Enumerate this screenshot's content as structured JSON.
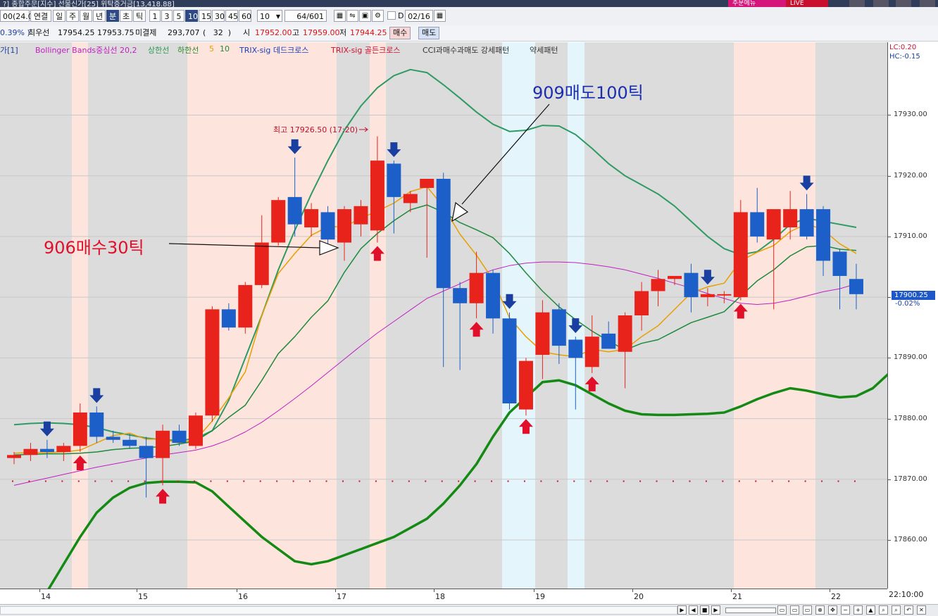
{
  "titlebar": {
    "text": "?] 종합주문[지수] 선물신가[25] 위탁증거금[13,418.88]",
    "btn_a": "주문메뉴",
    "btn_b": "LIVE"
  },
  "toolbar": {
    "code": "00(24.0",
    "link_label": "연결",
    "periods": [
      "일",
      "주",
      "월",
      "년",
      "분",
      "초",
      "틱"
    ],
    "active_period": "분",
    "intervals": [
      "1",
      "3",
      "5",
      "10",
      "15",
      "30",
      "45",
      "60"
    ],
    "active_interval": "10",
    "interval_value": "10",
    "count": "64",
    "count_total": "/601",
    "d_label": "D",
    "date": "02/16"
  },
  "quote": {
    "pct": "0.39%",
    "best_ask_label": "최우선",
    "best_ask": "17954.25",
    "best_bid": "17953.75",
    "unsettled_label": "미결제",
    "unsettled": "293,707",
    "unsettled_chg": "32",
    "open_label": "시",
    "open": "17952.00",
    "high_label": "고",
    "high": "17959.00",
    "low_label": "저",
    "low": "17944.25",
    "buy_label": "매수",
    "sell_label": "매도"
  },
  "legend": {
    "price": "가[1]",
    "bb": "Bollinger Bands중심선 20,2",
    "upper": "상한선",
    "lower": "하한선",
    "ma5": "5",
    "ma10": "10",
    "trix_dead": "TRIX-sig 데드크로스",
    "trix_golden": "TRIX-sig 골든크로스",
    "cci": "CCI과매수과매도 강세패턴",
    "weak": "약세패턴"
  },
  "annotations": {
    "buy_note": "906매수30틱",
    "sell_note": "909매도100틱",
    "high_marker": "최고 17926.50 (17:20)"
  },
  "axis_right": {
    "lc": "LC:0.20",
    "hc": "HC:-0.15",
    "ticks": [
      "17930.00",
      "17920.00",
      "17910.00",
      "17900.00",
      "17890.00",
      "17880.00",
      "17870.00",
      "17860.00"
    ],
    "last_price": "17900.25",
    "last_pct": "-0.02%",
    "time": "22:10:00"
  },
  "chart_data": {
    "type": "candlestick",
    "x_labels": [
      "14",
      "15",
      "16",
      "17",
      "18",
      "19",
      "20",
      "21",
      "22"
    ],
    "ylim": [
      17852,
      17942
    ],
    "candles": [
      {
        "o": 17873.5,
        "h": 17874.5,
        "l": 17872.5,
        "c": 17874.0
      },
      {
        "o": 17874.0,
        "h": 17876.0,
        "l": 17873.0,
        "c": 17875.0
      },
      {
        "o": 17875.0,
        "h": 17876.5,
        "l": 17873.5,
        "c": 17874.5
      },
      {
        "o": 17874.5,
        "h": 17876.0,
        "l": 17873.0,
        "c": 17875.5
      },
      {
        "o": 17875.5,
        "h": 17882.5,
        "l": 17874.5,
        "c": 17881.0
      },
      {
        "o": 17881.0,
        "h": 17882.0,
        "l": 17876.0,
        "c": 17877.0
      },
      {
        "o": 17877.0,
        "h": 17878.0,
        "l": 17876.0,
        "c": 17876.5
      },
      {
        "o": 17876.5,
        "h": 17877.5,
        "l": 17875.0,
        "c": 17875.5
      },
      {
        "o": 17875.5,
        "h": 17877.0,
        "l": 17867.0,
        "c": 17873.5
      },
      {
        "o": 17873.5,
        "h": 17879.0,
        "l": 17869.0,
        "c": 17878.0
      },
      {
        "o": 17878.0,
        "h": 17879.0,
        "l": 17875.5,
        "c": 17876.0
      },
      {
        "o": 17875.5,
        "h": 17881.0,
        "l": 17875.0,
        "c": 17880.5
      },
      {
        "o": 17880.5,
        "h": 17898.5,
        "l": 17879.5,
        "c": 17898.0
      },
      {
        "o": 17898.0,
        "h": 17899.0,
        "l": 17894.5,
        "c": 17895.0
      },
      {
        "o": 17895.0,
        "h": 17902.5,
        "l": 17894.0,
        "c": 17902.0
      },
      {
        "o": 17902.0,
        "h": 17913.5,
        "l": 17901.5,
        "c": 17909.0
      },
      {
        "o": 17909.0,
        "h": 17916.5,
        "l": 17908.5,
        "c": 17916.0
      },
      {
        "o": 17916.5,
        "h": 17923.0,
        "l": 17910.0,
        "c": 17912.0
      },
      {
        "o": 17911.5,
        "h": 17915.5,
        "l": 17910.0,
        "c": 17914.5
      },
      {
        "o": 17914.0,
        "h": 17915.0,
        "l": 17907.5,
        "c": 17909.5
      },
      {
        "o": 17909.0,
        "h": 17915.0,
        "l": 17906.0,
        "c": 17914.5
      },
      {
        "o": 17912.0,
        "h": 17916.0,
        "l": 17910.0,
        "c": 17915.0
      },
      {
        "o": 17911.0,
        "h": 17926.5,
        "l": 17909.0,
        "c": 17922.5
      },
      {
        "o": 17922.0,
        "h": 17922.5,
        "l": 17910.5,
        "c": 17916.5
      },
      {
        "o": 17915.5,
        "h": 17917.5,
        "l": 17914.0,
        "c": 17917.0
      },
      {
        "o": 17918.0,
        "h": 17919.0,
        "l": 17906.5,
        "c": 17919.5
      },
      {
        "o": 17919.5,
        "h": 17920.5,
        "l": 17888.5,
        "c": 17901.5
      },
      {
        "o": 17901.5,
        "h": 17902.5,
        "l": 17888.0,
        "c": 17899.0
      },
      {
        "o": 17899.0,
        "h": 17907.5,
        "l": 17896.5,
        "c": 17904.0
      },
      {
        "o": 17904.0,
        "h": 17904.5,
        "l": 17894.0,
        "c": 17896.5
      },
      {
        "o": 17896.5,
        "h": 17897.5,
        "l": 17881.5,
        "c": 17882.5
      },
      {
        "o": 17881.5,
        "h": 17890.0,
        "l": 17880.5,
        "c": 17889.5
      },
      {
        "o": 17890.5,
        "h": 17899.5,
        "l": 17886.5,
        "c": 17897.5
      },
      {
        "o": 17898.0,
        "h": 17899.0,
        "l": 17889.0,
        "c": 17892.0
      },
      {
        "o": 17893.0,
        "h": 17893.5,
        "l": 17881.5,
        "c": 17890.0
      },
      {
        "o": 17888.5,
        "h": 17897.0,
        "l": 17887.5,
        "c": 17893.5
      },
      {
        "o": 17894.0,
        "h": 17896.0,
        "l": 17891.5,
        "c": 17891.5
      },
      {
        "o": 17891.0,
        "h": 17897.5,
        "l": 17885.0,
        "c": 17897.0
      },
      {
        "o": 17897.0,
        "h": 17902.5,
        "l": 17894.5,
        "c": 17901.0
      },
      {
        "o": 17901.0,
        "h": 17904.5,
        "l": 17898.5,
        "c": 17903.0
      },
      {
        "o": 17903.0,
        "h": 17903.5,
        "l": 17902.0,
        "c": 17903.5
      },
      {
        "o": 17904.0,
        "h": 17905.5,
        "l": 17897.5,
        "c": 17900.0
      },
      {
        "o": 17900.0,
        "h": 17901.5,
        "l": 17898.5,
        "c": 17900.5
      },
      {
        "o": 17900.5,
        "h": 17901.0,
        "l": 17899.0,
        "c": 17900.5
      },
      {
        "o": 17900.0,
        "h": 17916.0,
        "l": 17899.5,
        "c": 17914.0
      },
      {
        "o": 17914.0,
        "h": 17918.0,
        "l": 17909.0,
        "c": 17910.0
      },
      {
        "o": 17909.5,
        "h": 17914.5,
        "l": 17898.0,
        "c": 17914.5
      },
      {
        "o": 17911.5,
        "h": 17917.5,
        "l": 17909.5,
        "c": 17914.5
      },
      {
        "o": 17914.5,
        "h": 17917.0,
        "l": 17909.5,
        "c": 17910.0
      },
      {
        "o": 17914.5,
        "h": 17915.0,
        "l": 17903.5,
        "c": 17906.0
      },
      {
        "o": 17907.5,
        "h": 17908.0,
        "l": 17898.0,
        "c": 17903.5
      },
      {
        "o": 17903.0,
        "h": 17905.5,
        "l": 17898.0,
        "c": 17900.5
      }
    ],
    "ma5": [
      17874.3,
      17874.4,
      17874.4,
      17874.5,
      17874.8,
      17876.0,
      17877.2,
      17877.6,
      17876.6,
      17876.6,
      17876.0,
      17876.5,
      17879.6,
      17883.4,
      17887.7,
      17897.0,
      17903.9,
      17907.2,
      17910.2,
      17911.6,
      17911.6,
      17913.0,
      17914.2,
      17915.5,
      17917.4,
      17918.2,
      17914.9,
      17910.4,
      17906.9,
      17902.9,
      17896.6,
      17893.5,
      17891.0,
      17890.5,
      17890.2,
      17891.4,
      17891.0,
      17891.4,
      17893.5,
      17895.3,
      17898.0,
      17900.7,
      17901.7,
      17902.3,
      17906.0,
      17907.4,
      17908.5,
      17910.8,
      17912.1,
      17911.1,
      17908.8,
      17907.2
    ],
    "ma10": [
      17874.0,
      17874.1,
      17874.2,
      17874.2,
      17874.3,
      17874.5,
      17874.9,
      17875.1,
      17875.2,
      17875.4,
      17875.8,
      17876.3,
      17878.0,
      17880.2,
      17882.2,
      17886.3,
      17890.7,
      17893.5,
      17896.7,
      17899.4,
      17904.1,
      17908.0,
      17910.5,
      17912.6,
      17914.4,
      17915.2,
      17914.0,
      17912.3,
      17911.1,
      17909.8,
      17907.2,
      17904.0,
      17901.0,
      17898.4,
      17896.3,
      17894.4,
      17892.8,
      17891.3,
      17892.4,
      17893.0,
      17894.4,
      17895.8,
      17896.7,
      17897.6,
      17900.2,
      17902.7,
      17904.5,
      17906.8,
      17908.3,
      17908.5,
      17907.9,
      17907.7
    ],
    "bb_mid": [
      17869.0,
      17869.6,
      17870.2,
      17870.8,
      17871.4,
      17872.0,
      17872.5,
      17873.0,
      17873.5,
      17874.0,
      17874.4,
      17874.8,
      17875.5,
      17876.5,
      17877.8,
      17879.4,
      17881.3,
      17883.3,
      17885.4,
      17887.6,
      17889.8,
      17892.0,
      17894.1,
      17896.0,
      17897.9,
      17899.8,
      17901.0,
      17902.2,
      17903.5,
      17904.5,
      17905.2,
      17905.6,
      17905.8,
      17905.8,
      17905.7,
      17905.4,
      17905.0,
      17904.5,
      17903.8,
      17903.1,
      17902.3,
      17901.5,
      17900.6,
      17899.8,
      17899.0,
      17898.8,
      17899.0,
      17899.5,
      17900.2,
      17900.9,
      17901.4,
      17902.2
    ],
    "bb_upper": [
      17879.0,
      17879.2,
      17879.3,
      17879.2,
      17879.0,
      17878.5,
      17877.8,
      17877.3,
      17876.8,
      17876.5,
      17876.4,
      17876.7,
      17878.0,
      17883.0,
      17890.0,
      17897.0,
      17904.5,
      17911.0,
      17917.0,
      17922.5,
      17927.5,
      17931.5,
      17934.5,
      17936.5,
      17937.5,
      17937.0,
      17935.0,
      17932.8,
      17930.5,
      17928.5,
      17927.3,
      17927.5,
      17928.3,
      17928.2,
      17926.8,
      17924.5,
      17922.0,
      17920.0,
      17918.5,
      17917.0,
      17915.0,
      17912.5,
      17910.0,
      17908.0,
      17907.0,
      17907.5,
      17909.5,
      17912.0,
      17913.0,
      17912.5,
      17912.0,
      17911.5
    ],
    "bb_lower": [
      17846.0,
      17848.0,
      17851.5,
      17856.0,
      17860.5,
      17864.5,
      17867.0,
      17868.6,
      17869.4,
      17869.6,
      17869.6,
      17869.5,
      17868.0,
      17865.5,
      17863.0,
      17860.5,
      17858.5,
      17856.5,
      17856.0,
      17856.5,
      17857.5,
      17858.5,
      17859.5,
      17860.5,
      17862.0,
      17863.5,
      17866.0,
      17869.0,
      17872.5,
      17877.0,
      17881.0,
      17883.5,
      17886.0,
      17886.3,
      17885.5,
      17884.0,
      17882.5,
      17881.3,
      17880.7,
      17880.6,
      17880.6,
      17880.7,
      17880.8,
      17881.0,
      17882.0,
      17883.2,
      17884.2,
      17885.0,
      17884.6,
      17884.0,
      17883.5,
      17883.7,
      17885.0,
      17887.5
    ]
  }
}
